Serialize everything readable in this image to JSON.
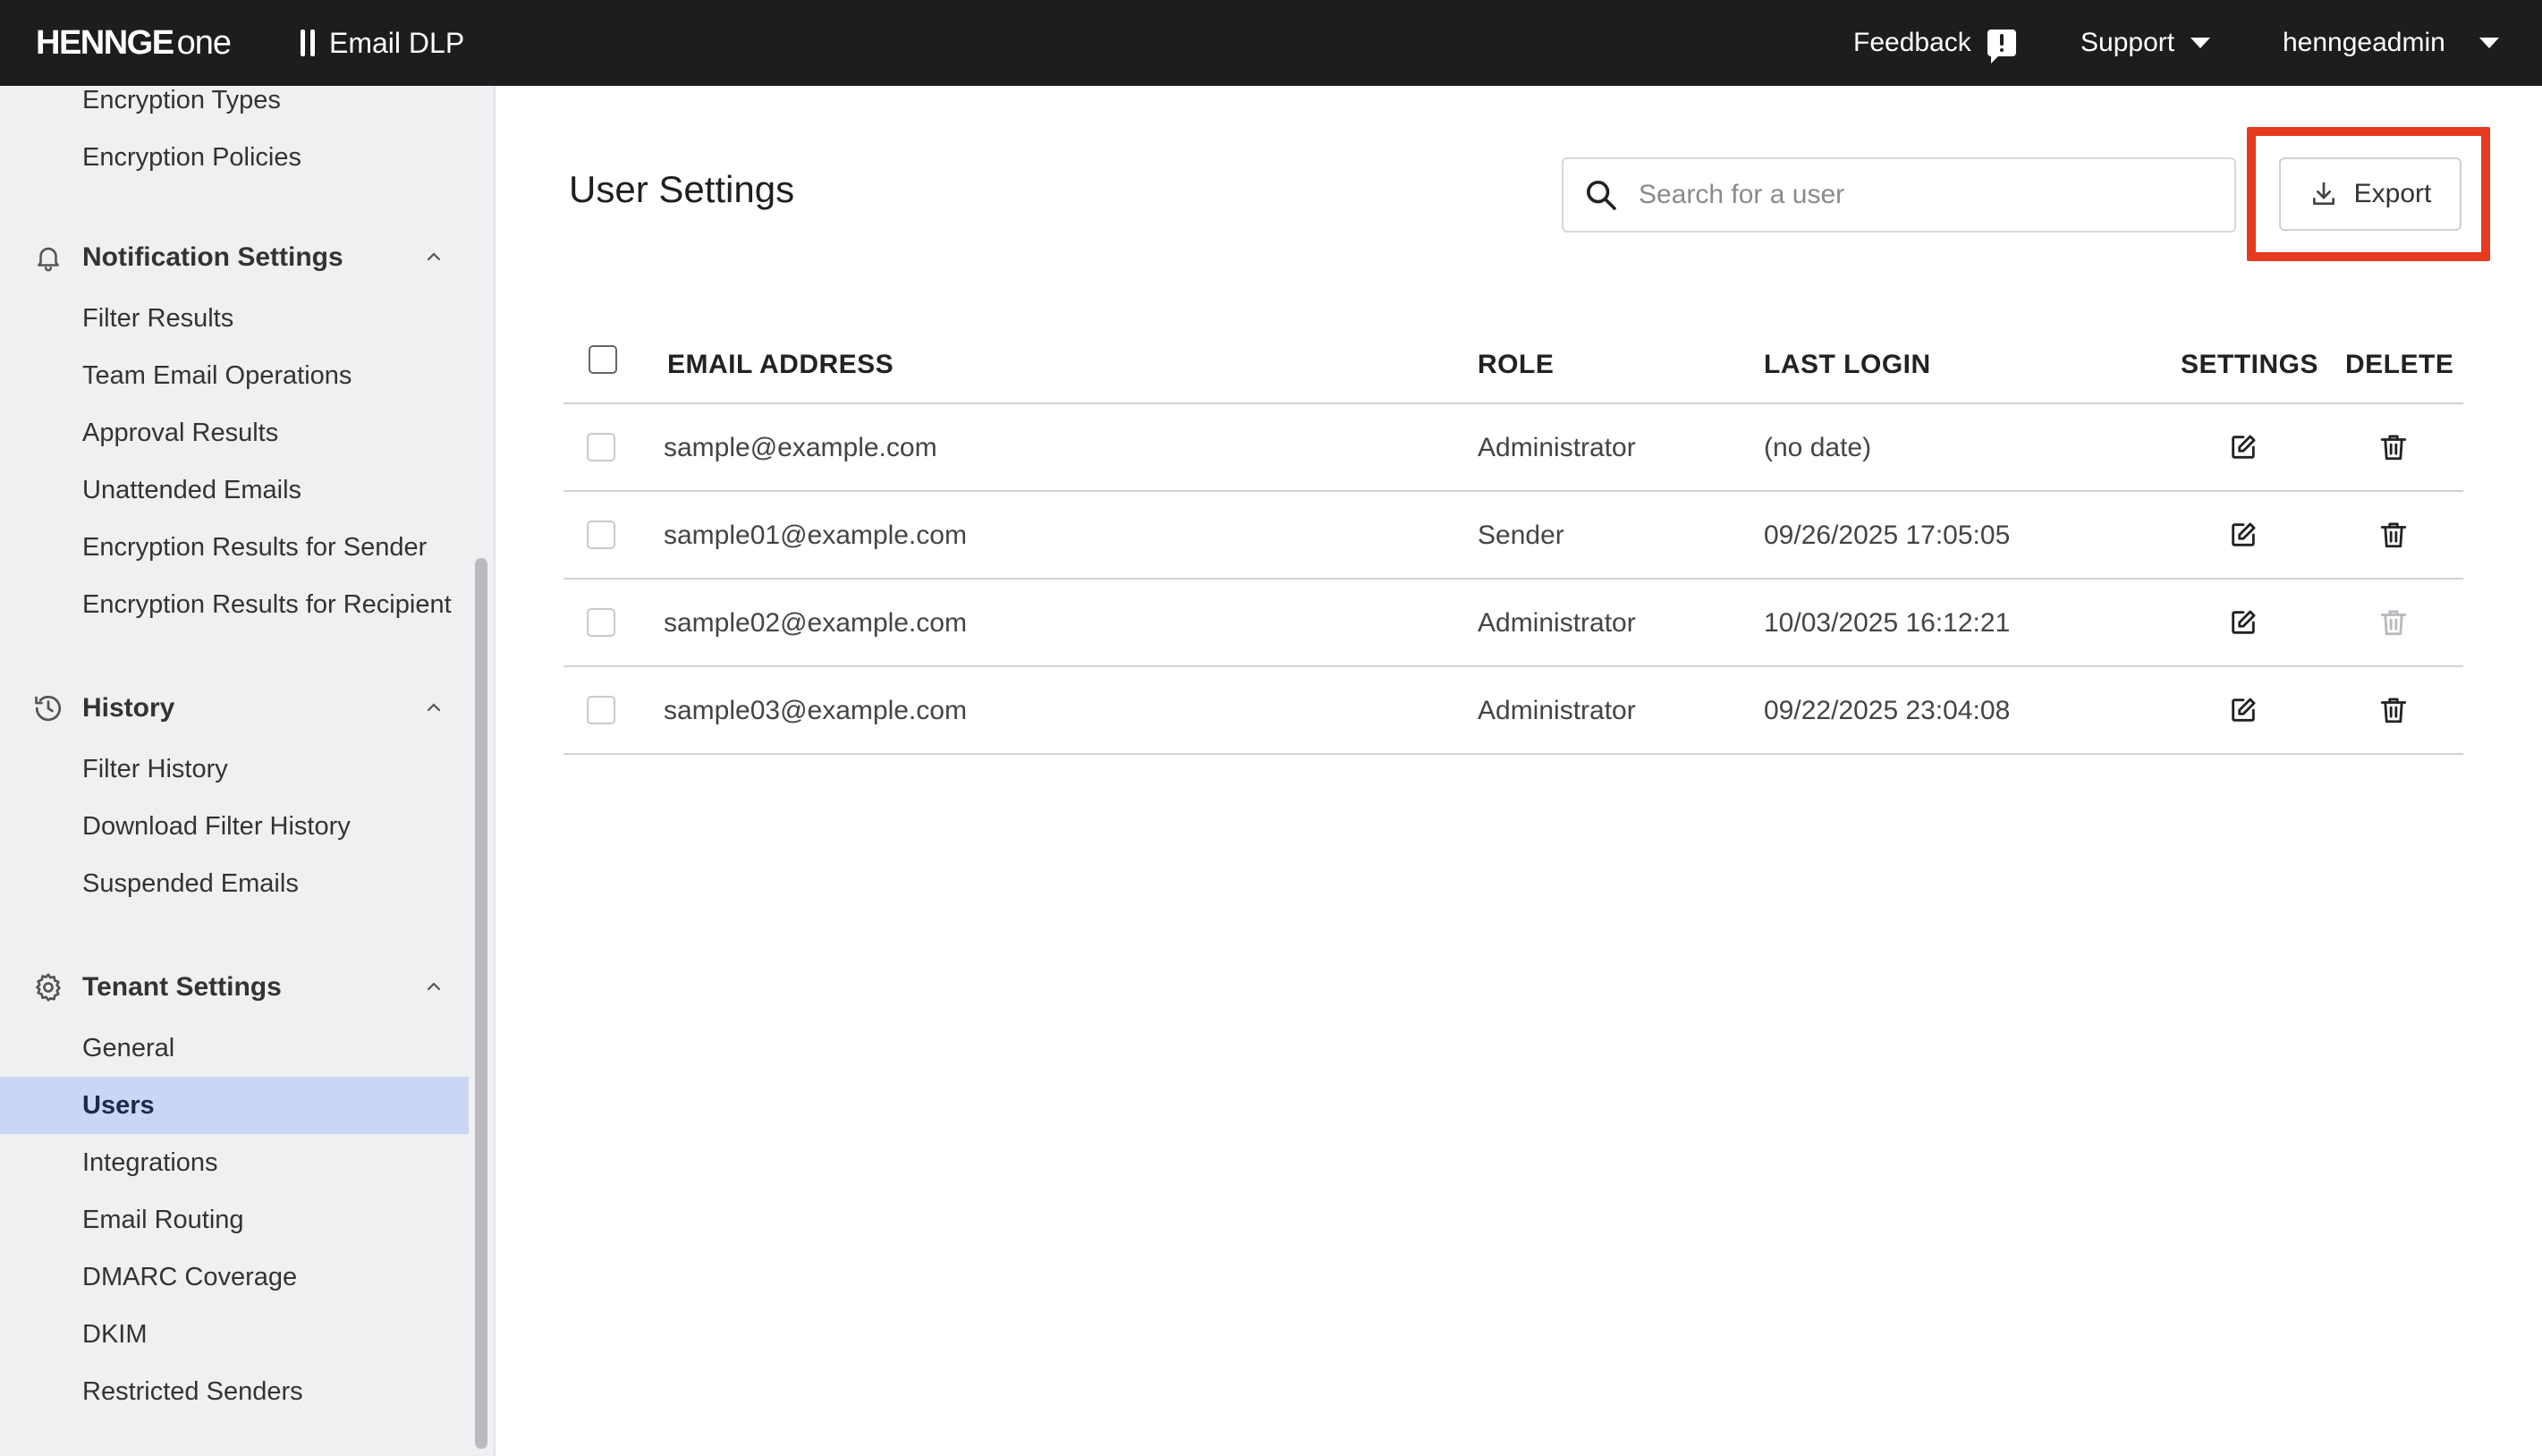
{
  "header": {
    "brand_main": "HENNGE",
    "brand_sub": "one",
    "product": "Email DLP",
    "feedback_label": "Feedback",
    "support_label": "Support",
    "account_label": "henngeadmin"
  },
  "sidebar": {
    "items_top": [
      "Encryption Types",
      "Encryption Policies"
    ],
    "sections": [
      {
        "label": "Notification Settings",
        "icon": "bell-icon",
        "items": [
          "Filter Results",
          "Team Email Operations",
          "Approval Results",
          "Unattended Emails",
          "Encryption Results for Sender",
          "Encryption Results for Recipient"
        ]
      },
      {
        "label": "History",
        "icon": "history-icon",
        "items": [
          "Filter History",
          "Download Filter History",
          "Suspended Emails"
        ]
      },
      {
        "label": "Tenant Settings",
        "icon": "gear-icon",
        "items": [
          "General",
          "Users",
          "Integrations",
          "Email Routing",
          "DMARC Coverage",
          "DKIM",
          "Restricted Senders"
        ]
      }
    ],
    "active_item": "Users"
  },
  "main": {
    "title": "User Settings",
    "search_placeholder": "Search for a user",
    "export_label": "Export",
    "columns": {
      "email": "EMAIL ADDRESS",
      "role": "ROLE",
      "last_login": "LAST LOGIN",
      "settings": "SETTINGS",
      "delete": "DELETE"
    },
    "rows": [
      {
        "email": "sample@example.com",
        "role": "Administrator",
        "last_login": "(no date)",
        "delete_enabled": true
      },
      {
        "email": "sample01@example.com",
        "role": "Sender",
        "last_login": "09/26/2025 17:05:05",
        "delete_enabled": true
      },
      {
        "email": "sample02@example.com",
        "role": "Administrator",
        "last_login": "10/03/2025 16:12:21",
        "delete_enabled": false
      },
      {
        "email": "sample03@example.com",
        "role": "Administrator",
        "last_login": "09/22/2025 23:04:08",
        "delete_enabled": true
      }
    ]
  },
  "colors": {
    "topbar": "#1d1d1f",
    "active_nav": "#cad6f3",
    "highlight": "#e63a1f"
  }
}
